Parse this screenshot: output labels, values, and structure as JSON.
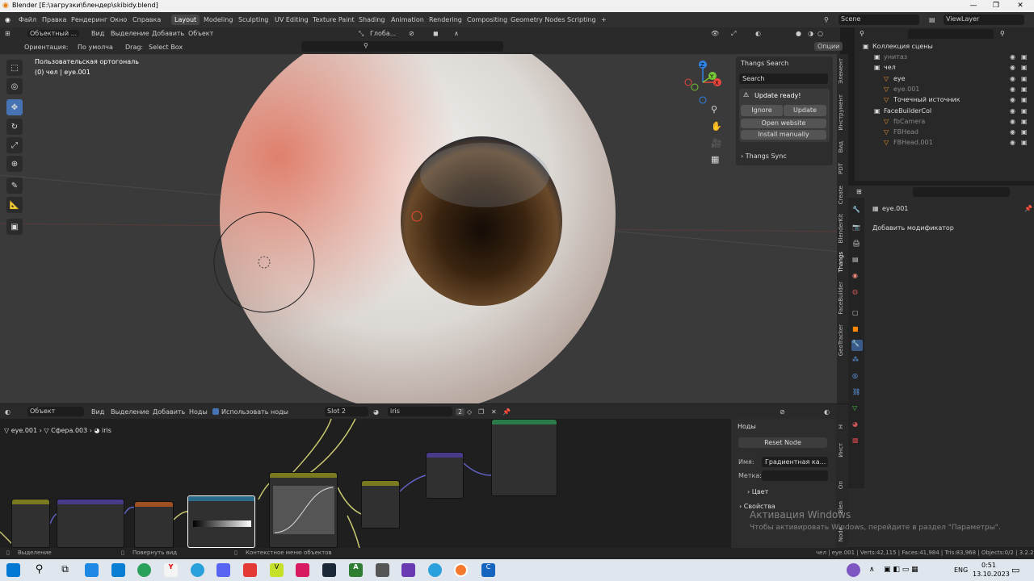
{
  "window": {
    "title": "Blender [E:\\загрузки\\блендер\\skibidy.blend]",
    "minimize": "—",
    "maximize": "❐",
    "close": "✕"
  },
  "menu": {
    "items": [
      "Файл",
      "Правка",
      "Рендеринг",
      "Окно",
      "Справка"
    ]
  },
  "workspaces": [
    "Layout",
    "Modeling",
    "Sculpting",
    "UV Editing",
    "Texture Paint",
    "Shading",
    "Animation",
    "Rendering",
    "Compositing",
    "Geometry Nodes",
    "Scripting"
  ],
  "active_workspace": "Layout",
  "scene": {
    "name": "Scene",
    "view_layer": "ViewLayer"
  },
  "viewport": {
    "mode": "Объектный ...",
    "menu": [
      "Вид",
      "Выделение",
      "Добавить",
      "Объект"
    ],
    "transform": "Глоба...",
    "orientation_label": "Ориентация:",
    "orientation_value": "По умолча",
    "drag_label": "Drag:",
    "drag_value": "Select Box",
    "options": "Опции",
    "view_name": "Пользовательская ортогональ",
    "object_info": "(0) чел | eye.001"
  },
  "gizmo": {
    "x": "X",
    "y": "Y",
    "z": "Z"
  },
  "things": {
    "title": "Thangs Search",
    "search_placeholder": "Search",
    "update_text": "Update ready!",
    "ignore": "Ignore",
    "update": "Update",
    "open_website": "Open website",
    "install": "Install manually",
    "sync": "Thangs Sync"
  },
  "side_tabs": [
    "Элемент",
    "Инструмент",
    "Вид",
    "PDT",
    "Create",
    "BlenderKit",
    "Thangs",
    "FaceBuilder",
    "GeoTracker"
  ],
  "outliner": {
    "root": "Коллекция сцены",
    "items": [
      {
        "label": "унитаз",
        "indent": 1,
        "dim": true
      },
      {
        "label": "чел",
        "indent": 1,
        "dim": false
      },
      {
        "label": "eye",
        "indent": 2,
        "dim": false
      },
      {
        "label": "eye.001",
        "indent": 2,
        "dim": true
      },
      {
        "label": "Точечный источник",
        "indent": 2,
        "dim": false
      },
      {
        "label": "FaceBuilderCol",
        "indent": 1,
        "dim": false
      },
      {
        "label": "fbCamera",
        "indent": 2,
        "dim": true
      },
      {
        "label": "FBHead",
        "indent": 2,
        "dim": true
      },
      {
        "label": "FBHead.001",
        "indent": 2,
        "dim": true
      }
    ]
  },
  "properties": {
    "object": "eye.001",
    "add_modifier": "Добавить модификатор"
  },
  "node_editor": {
    "mode": "Объект",
    "menu": [
      "Вид",
      "Выделение",
      "Добавить",
      "Ноды"
    ],
    "use_nodes": "Использовать ноды",
    "slot": "Slot 2",
    "material": "iris",
    "users": "2",
    "breadcrumb": [
      "eye.001",
      "Сфера.003",
      "iris"
    ],
    "side_title": "Ноды",
    "reset_node": "Reset Node",
    "name_label": "Имя:",
    "name_value": "Градиентная ка...",
    "label_label": "Метка:",
    "color_section": "Цвет",
    "props_section": "Свойства",
    "tabs": [
      "Н",
      "Инст",
      "Оп",
      "Blen",
      "Node"
    ]
  },
  "activation": {
    "title": "Активация Windows",
    "text": "Чтобы активировать Windows, перейдите в раздел \"Параметры\"."
  },
  "statusbar": {
    "select": "Выделение",
    "rotate": "Повернуть вид",
    "context": "Контекстное меню объектов",
    "stats": "чел | eye.001 | Verts:42,115 | Faces:41,984 | Tris:83,968 | Objects:0/2 | 3.2.2"
  },
  "taskbar": {
    "lang": "ENG",
    "time": "0:51",
    "date": "13.10.2023"
  }
}
